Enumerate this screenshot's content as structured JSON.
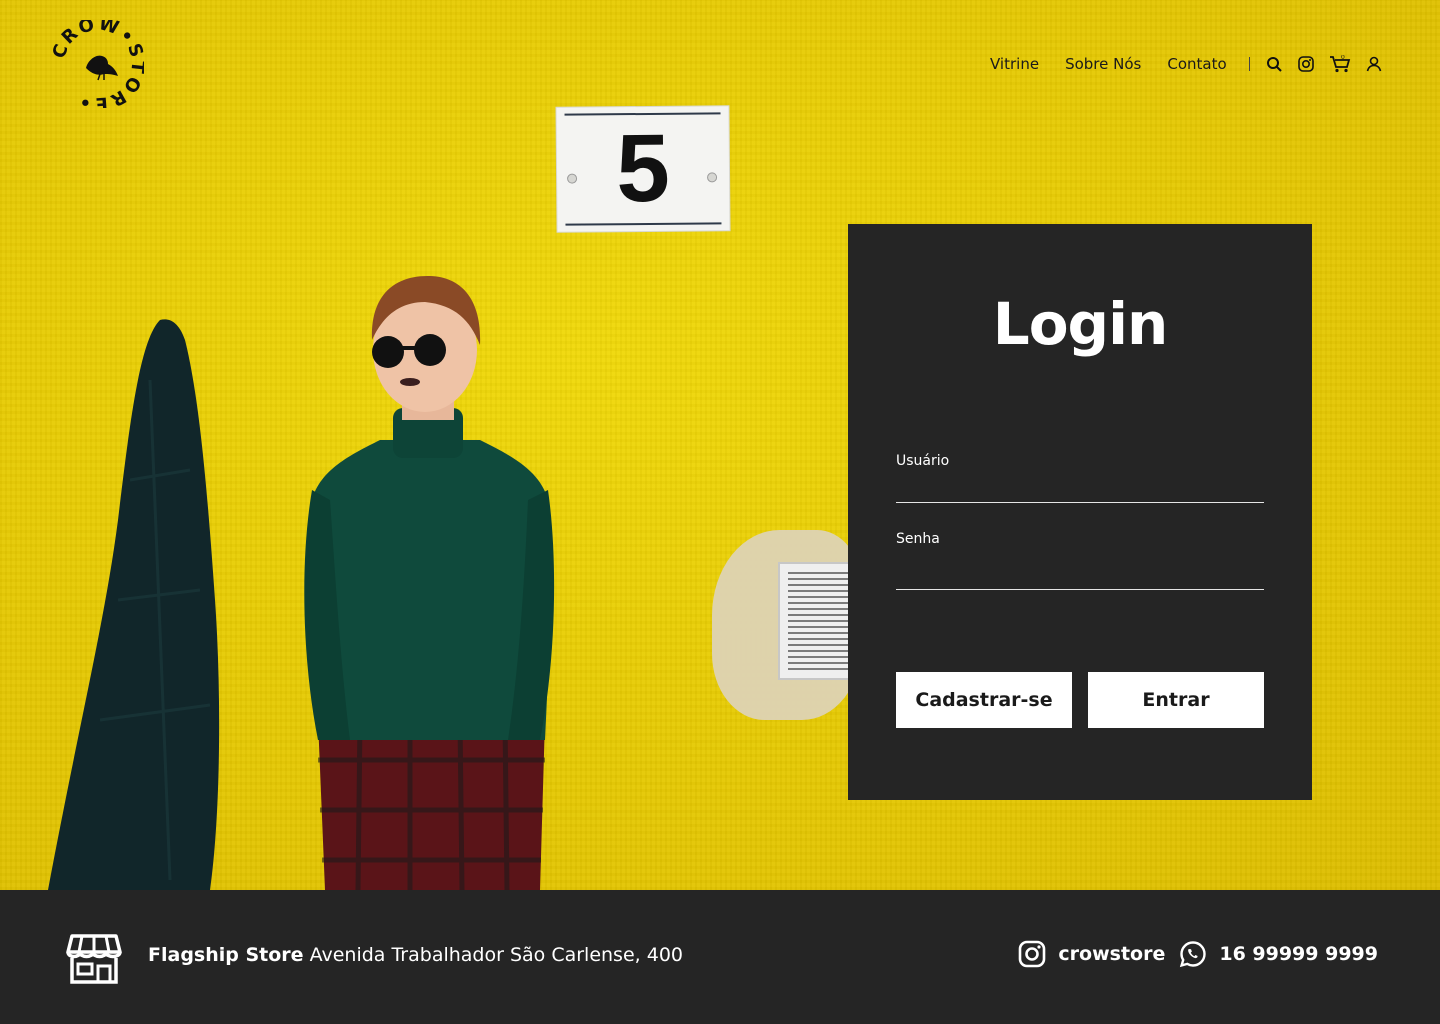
{
  "brand": {
    "logo_text": "CROW•STORE•"
  },
  "nav": {
    "links": [
      "Vitrine",
      "Sobre Nós",
      "Contato"
    ],
    "icons": [
      "search-icon",
      "instagram-icon",
      "cart-icon",
      "user-icon"
    ]
  },
  "hero": {
    "plate_number": "5"
  },
  "login": {
    "title": "Login",
    "username_label": "Usuário",
    "username_value": "",
    "password_label": "Senha",
    "password_value": "",
    "signup_button": "Cadastrar-se",
    "submit_button": "Entrar"
  },
  "footer": {
    "store_label": "Flagship Store",
    "address": "Avenida Trabalhador São Carlense, 400",
    "instagram": "crowstore",
    "phone": "16 99999 9999"
  },
  "colors": {
    "accent_yellow": "#e8cc04",
    "dark": "#252525",
    "white": "#ffffff"
  }
}
